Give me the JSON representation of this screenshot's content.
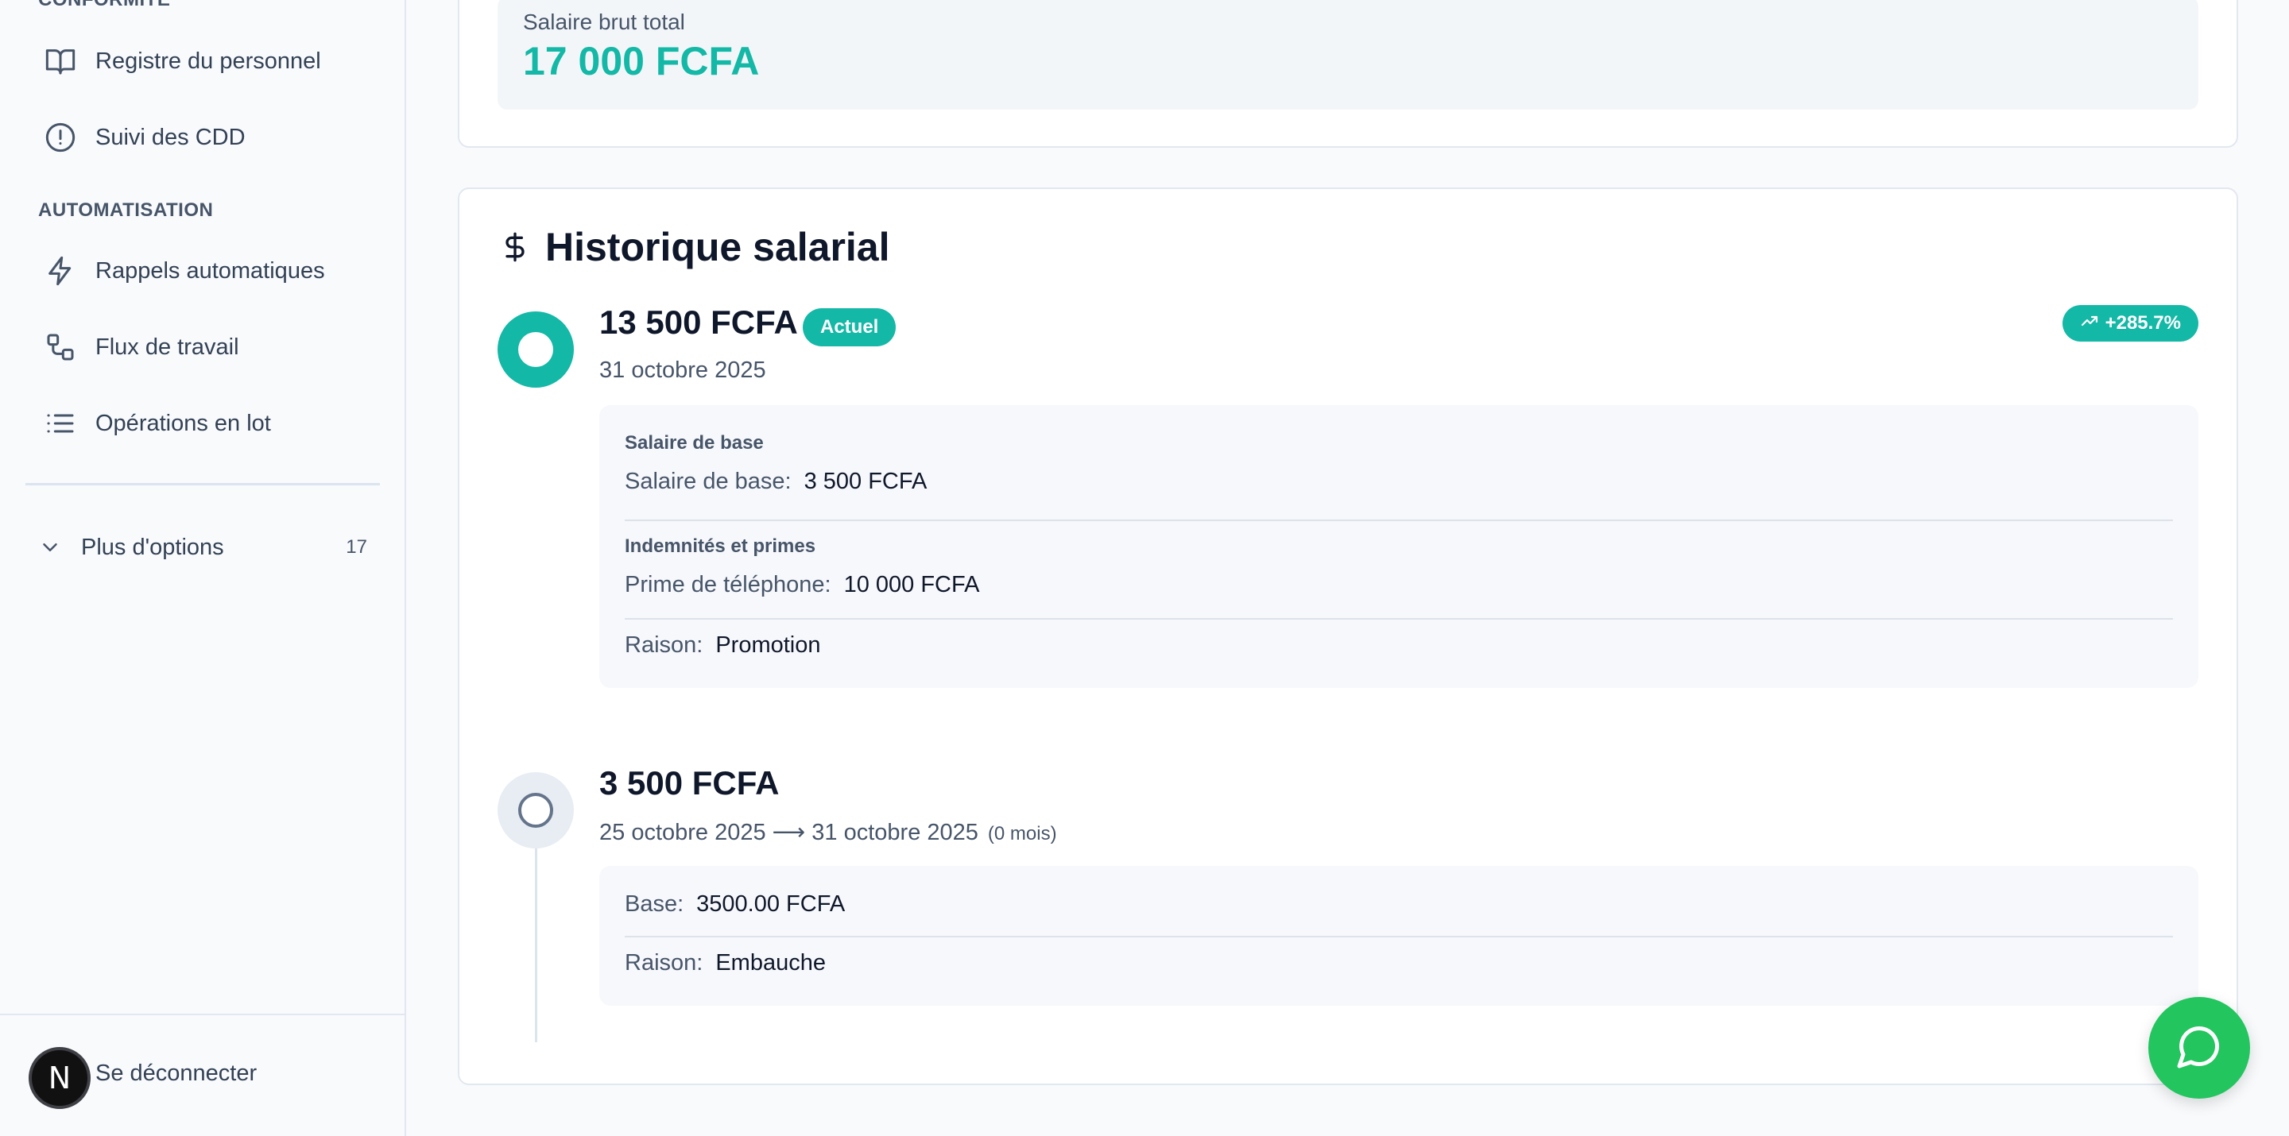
{
  "sidebar": {
    "section_conformite": "CONFORMITÉ",
    "section_automatisation": "AUTOMATISATION",
    "items": [
      {
        "label": "Registre du personnel",
        "icon": "book-open-icon"
      },
      {
        "label": "Suivi des CDD",
        "icon": "alert-circle-icon"
      },
      {
        "label": "Rappels automatiques",
        "icon": "zap-icon"
      },
      {
        "label": "Flux de travail",
        "icon": "workflow-icon"
      },
      {
        "label": "Opérations en lot",
        "icon": "list-icon"
      }
    ],
    "more": {
      "label": "Plus d'options",
      "count": "17"
    },
    "logout": {
      "label": "Se déconnecter",
      "avatar_letter": "N"
    }
  },
  "summary": {
    "gross_label": "Salaire brut total",
    "gross_value": "17 000 FCFA"
  },
  "history": {
    "title": "Historique salarial",
    "entries": [
      {
        "amount": "13 500 FCFA",
        "badge": "Actuel",
        "change": "+285.7%",
        "date": "31 octobre 2025",
        "base_heading": "Salaire de base",
        "base_key": "Salaire de base:",
        "base_value": "3 500 FCFA",
        "allowances_heading": "Indemnités et primes",
        "allowance_key": "Prime de téléphone:",
        "allowance_value": "10 000 FCFA",
        "reason_key": "Raison:",
        "reason_value": "Promotion"
      },
      {
        "amount": "3 500 FCFA",
        "date": "25 octobre 2025 ⟶ 31 octobre 2025",
        "duration": "(0 mois)",
        "base_key": "Base:",
        "base_value": "3500.00 FCFA",
        "reason_key": "Raison:",
        "reason_value": "Embauche"
      }
    ]
  },
  "colors": {
    "accent": "#14b8a6",
    "chat": "#22c55e"
  }
}
